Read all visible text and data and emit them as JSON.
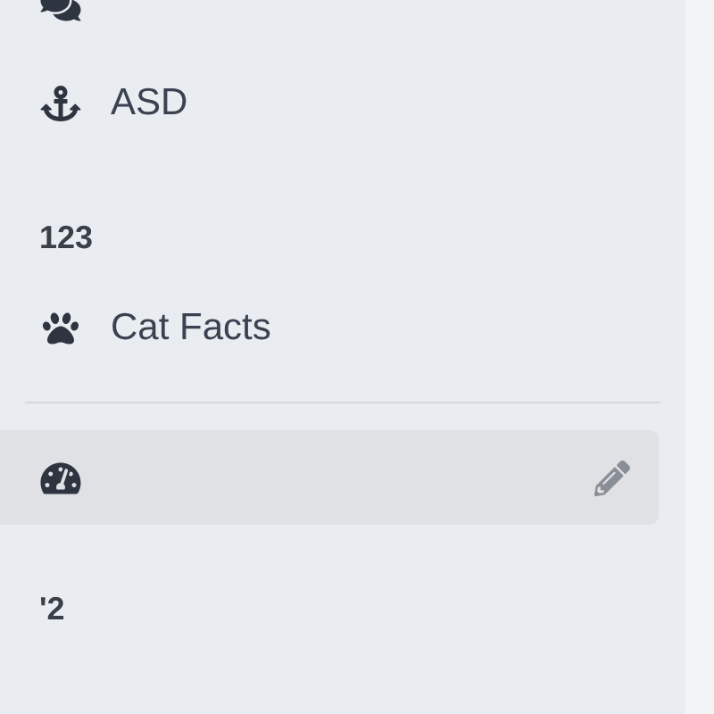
{
  "sidebar": {
    "items": [
      {
        "kind": "item",
        "selected": false
      },
      {
        "kind": "item",
        "label": "ASD",
        "selected": false
      },
      {
        "kind": "heading",
        "label": "123"
      },
      {
        "kind": "item",
        "label": "Cat Facts",
        "selected": false
      },
      {
        "kind": "divider"
      },
      {
        "kind": "item",
        "selected": true
      },
      {
        "kind": "heading",
        "label": "'2"
      }
    ]
  }
}
